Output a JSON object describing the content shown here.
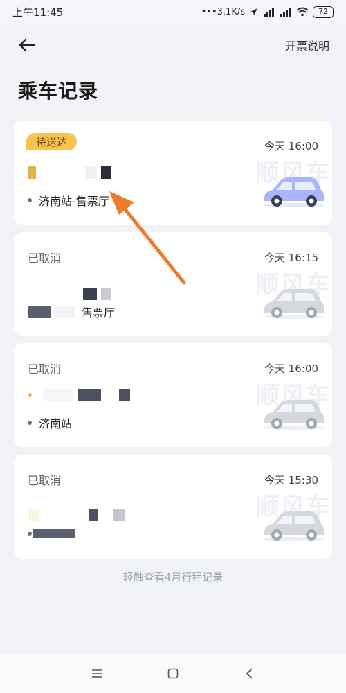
{
  "status_bar": {
    "time": "上午11:45",
    "network_speed": "•••3.1K/s",
    "battery": "72"
  },
  "header": {
    "invoice_label": "开票说明",
    "title": "乘车记录"
  },
  "rides": [
    {
      "status": "待送达",
      "time": "今天 16:00",
      "to": "济南站-售票厅",
      "watermark": "顺风车"
    },
    {
      "status": "已取消",
      "time": "今天 16:15",
      "to": "售票厅",
      "watermark": "顺风车"
    },
    {
      "status": "已取消",
      "time": "今天 16:00",
      "to": "济南站",
      "watermark": "顺风车"
    },
    {
      "status": "已取消",
      "time": "今天 15:30",
      "to": "",
      "watermark": "顺风车"
    }
  ],
  "footer": {
    "history_link": "轻触查看4月行程记录"
  },
  "colors": {
    "pending_badge": "#f8c451",
    "annotation_arrow": "#f07a2c",
    "active_car": "#aab4ff"
  }
}
